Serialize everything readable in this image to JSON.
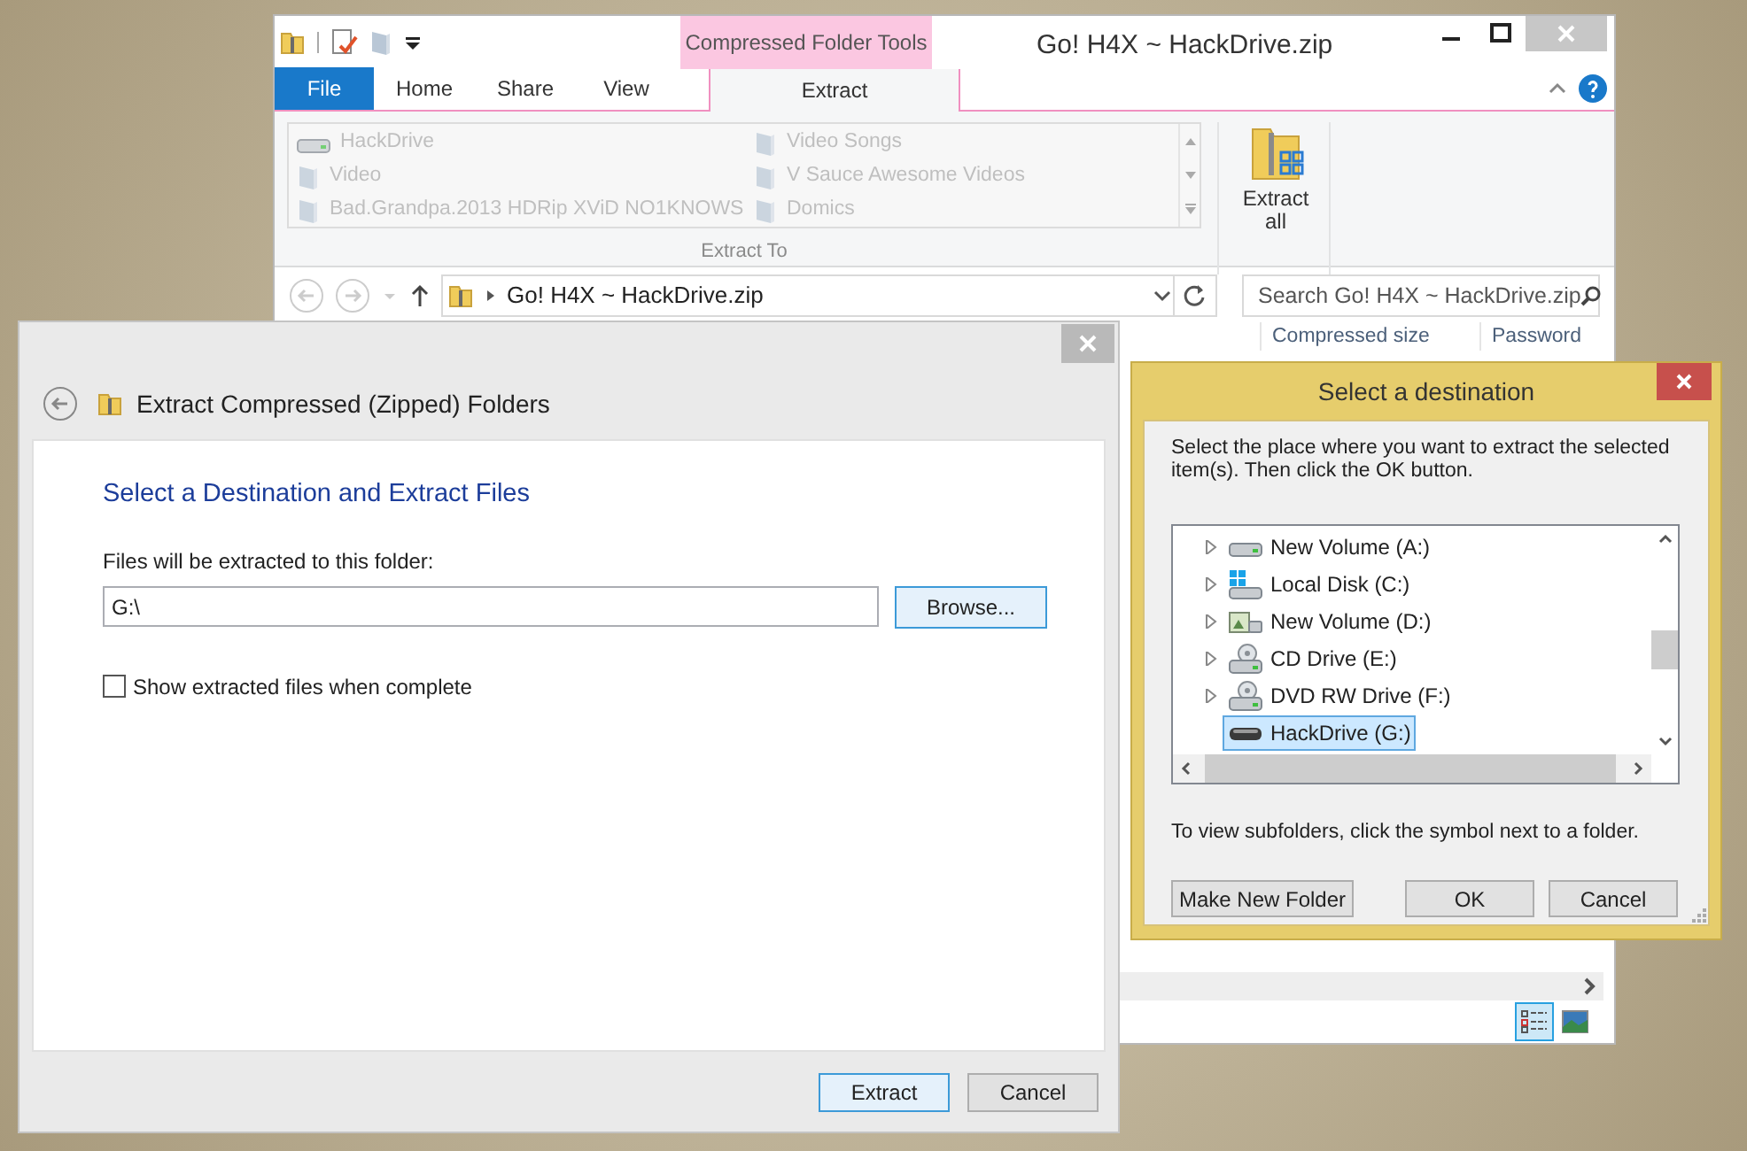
{
  "explorer": {
    "title": "Go! H4X ~ HackDrive.zip",
    "contextual_group": "Compressed Folder Tools",
    "tabs": [
      {
        "label": "File",
        "kind": "file",
        "selected": false
      },
      {
        "label": "Home",
        "kind": "tab",
        "selected": false
      },
      {
        "label": "Share",
        "kind": "tab",
        "selected": false
      },
      {
        "label": "View",
        "kind": "tab",
        "selected": false
      },
      {
        "label": "Extract",
        "kind": "contextual",
        "selected": true
      }
    ],
    "extract_to": [
      {
        "label": "HackDrive",
        "kind": "drive",
        "disabled": true
      },
      {
        "label": "Video",
        "kind": "folder",
        "disabled": true
      },
      {
        "label": "Bad.Grandpa.2013 HDRip XViD NO1KNOWS",
        "kind": "folder",
        "disabled": true
      },
      {
        "label": "Video Songs",
        "kind": "folder",
        "disabled": true
      },
      {
        "label": "V Sauce Awesome Videos",
        "kind": "folder",
        "disabled": true
      },
      {
        "label": "Domics",
        "kind": "folder",
        "disabled": true
      }
    ],
    "extract_to_label": "Extract To",
    "extract_all": "Extract all",
    "address": "Go! H4X ~ HackDrive.zip",
    "search_placeholder": "Search Go! H4X ~ HackDrive.zip",
    "columns": [
      "Compressed size",
      "Password"
    ]
  },
  "extract_dialog": {
    "title": "Extract Compressed (Zipped) Folders",
    "heading": "Select a Destination and Extract Files",
    "path_label": "Files will be extracted to this folder:",
    "path_value": "G:\\",
    "browse": "Browse...",
    "show_files": {
      "label": "Show extracted files when complete",
      "checked": false
    },
    "buttons": [
      "Extract",
      "Cancel"
    ]
  },
  "destination_dialog": {
    "title": "Select a destination",
    "instructions": "Select the place where you want to extract the selected item(s).  Then click the OK button.",
    "tree": [
      {
        "label": "New Volume (A:)",
        "kind": "drive",
        "expandable": true,
        "selected": false
      },
      {
        "label": "Local Disk (C:)",
        "kind": "system",
        "expandable": true,
        "selected": false
      },
      {
        "label": "New Volume (D:)",
        "kind": "media",
        "expandable": true,
        "selected": false
      },
      {
        "label": "CD Drive (E:)",
        "kind": "disc",
        "expandable": true,
        "selected": false
      },
      {
        "label": "DVD RW Drive (F:)",
        "kind": "disc",
        "expandable": true,
        "selected": false
      },
      {
        "label": "HackDrive (G:)",
        "kind": "usb",
        "expandable": false,
        "selected": true
      }
    ],
    "hint": "To view subfolders, click the symbol next to a folder.",
    "buttons": [
      "Make New Folder",
      "OK",
      "Cancel"
    ]
  }
}
